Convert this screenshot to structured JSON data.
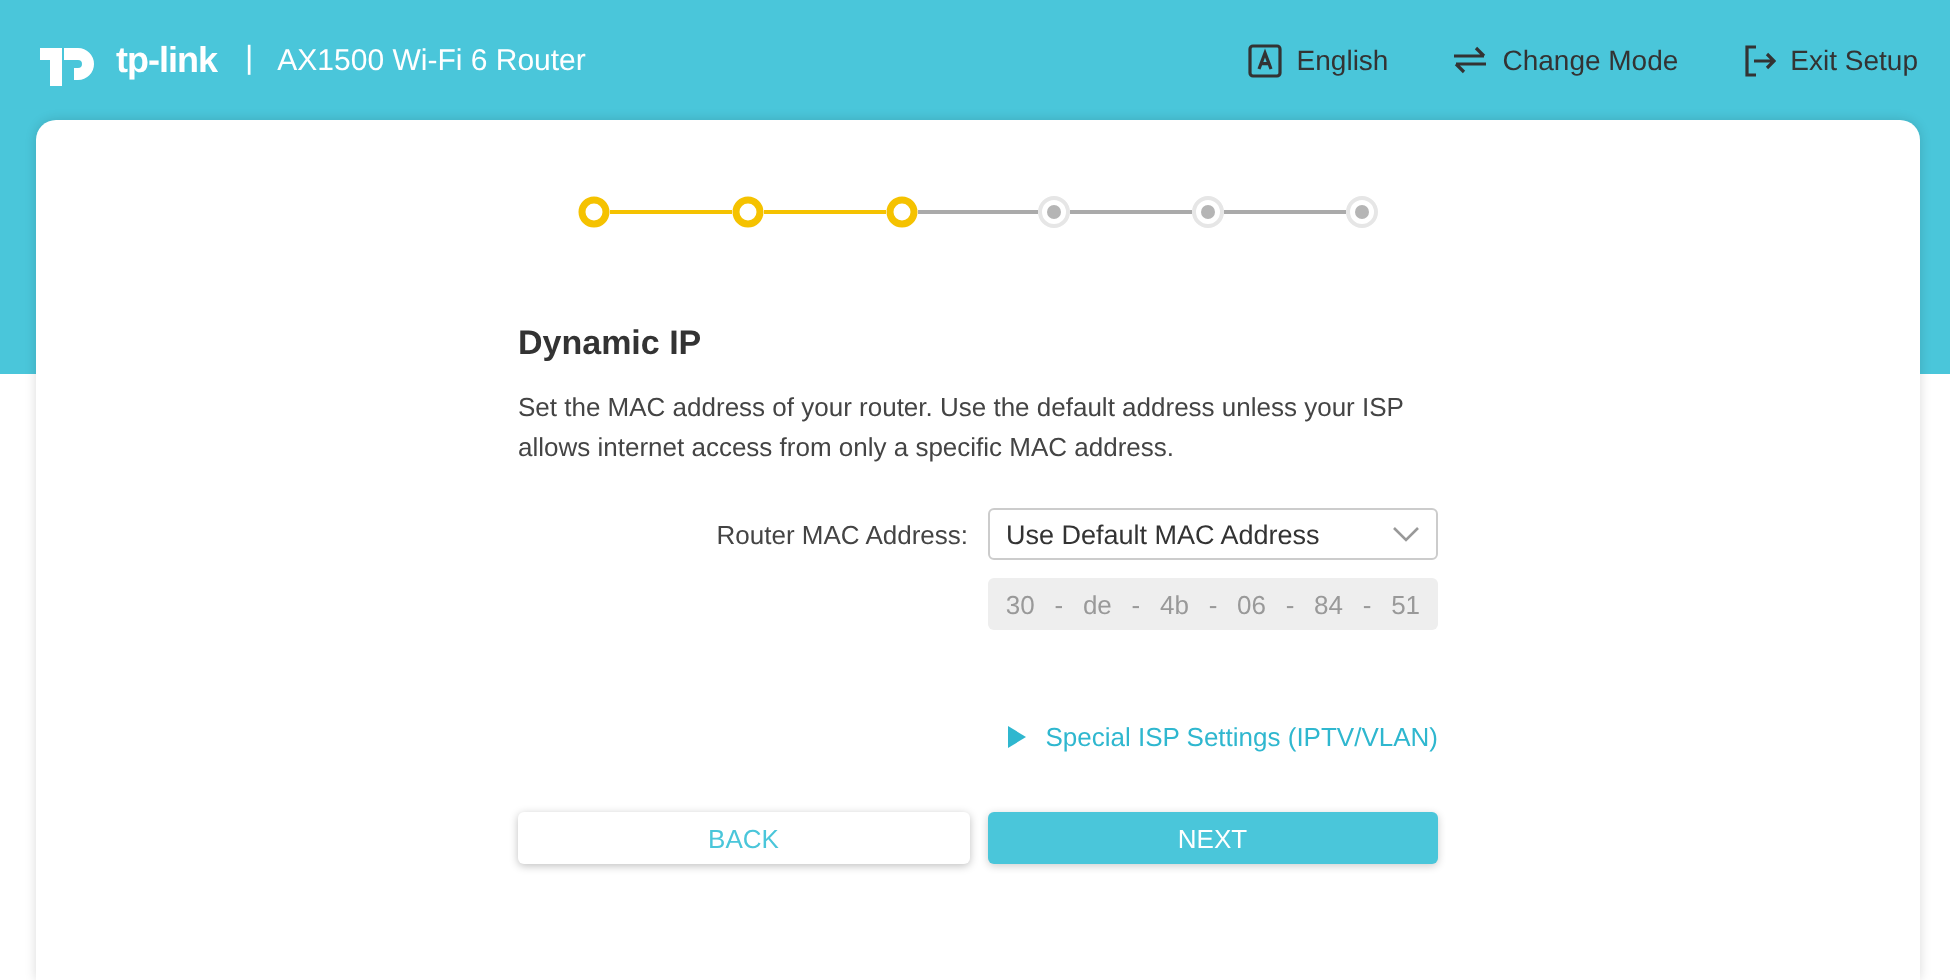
{
  "header": {
    "brand": "tp-link",
    "separator": "|",
    "product": "AX1500 Wi-Fi 6 Router",
    "actions": [
      {
        "kind": "language",
        "label": "English"
      },
      {
        "kind": "mode",
        "label": "Change Mode"
      },
      {
        "kind": "exit",
        "label": "Exit Setup"
      }
    ]
  },
  "steps": [
    {
      "done": true
    },
    {
      "done": true
    },
    {
      "done": true
    },
    {
      "done": false
    },
    {
      "done": false
    },
    {
      "done": false
    }
  ],
  "section": {
    "title": "Dynamic IP",
    "description": "Set the MAC address of your router. Use the default address unless your ISP allows internet access from only a specific MAC address."
  },
  "mac": {
    "label": "Router MAC Address:",
    "select_value": "Use Default MAC Address",
    "octets": [
      "30",
      "de",
      "4b",
      "06",
      "84",
      "51"
    ],
    "separators": [
      "-",
      "-",
      "-",
      "-",
      "-"
    ],
    "disabled": true
  },
  "advanced_link": {
    "label": "Special ISP Settings (IPTV/VLAN)",
    "expanded": false
  },
  "buttons": [
    {
      "kind": "secondary",
      "label": "BACK"
    },
    {
      "kind": "primary",
      "label": "NEXT"
    }
  ]
}
